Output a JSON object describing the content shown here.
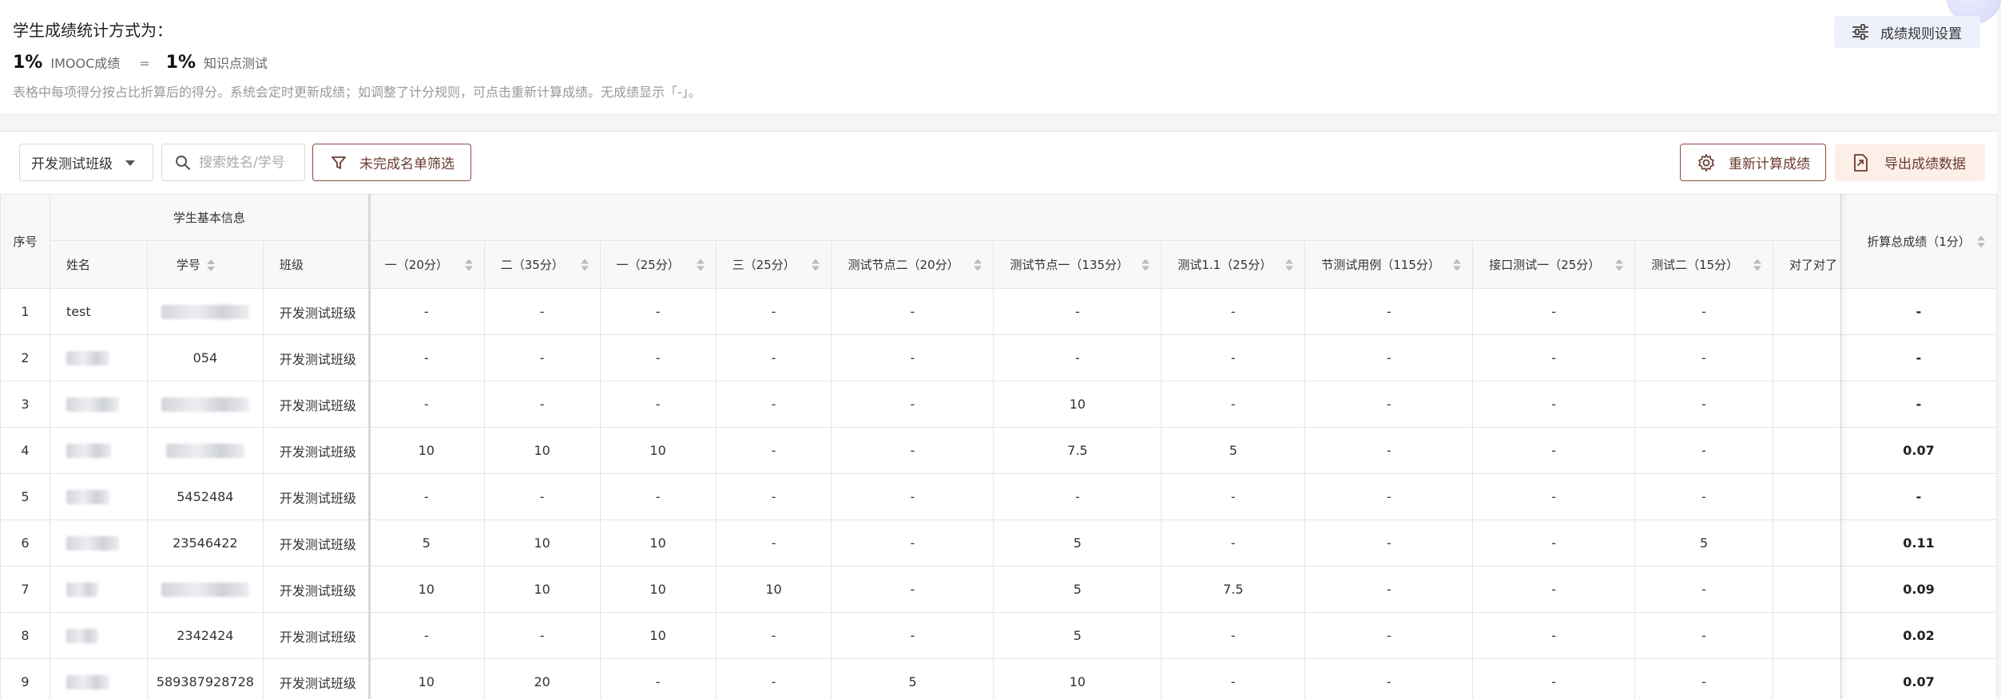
{
  "header": {
    "title": "学生成绩统计方式为：",
    "formula": {
      "part1_pct": "1%",
      "part1_label": "IMOOC成绩",
      "op": "=",
      "part2_pct": "1%",
      "part2_label": "知识点测试"
    },
    "hint": "表格中每项得分按占比折算后的得分。系统会定时更新成绩；如调整了计分规则，可点击重新计算成绩。无成绩显示「-」。",
    "rule_button": "成绩规则设置"
  },
  "toolbar": {
    "class_select": "开发测试班级",
    "search_placeholder": "搜索姓名/学号",
    "filter_button": "未完成名单筛选",
    "recalc_button": "重新计算成绩",
    "export_button": "导出成绩数据"
  },
  "table": {
    "index_header": "序号",
    "group_header": "学生基本信息",
    "info_columns": [
      "姓名",
      "学号",
      "班级"
    ],
    "score_columns": [
      "一（20分）",
      "二（35分）",
      "一（25分）",
      "三（25分）",
      "测试节点二（20分）",
      "测试节点一（135分）",
      "测试1.1（25分）",
      "节测试用例（115分）",
      "接口测试一（25分）",
      "测试二（15分）",
      "对了对了"
    ],
    "total_header": "折算总成绩（1分）",
    "rows": [
      {
        "idx": "1",
        "name": "test",
        "sid": "",
        "class": "开发测试班级",
        "scores": [
          "-",
          "-",
          "-",
          "-",
          "-",
          "-",
          "-",
          "-",
          "-",
          "-",
          ""
        ],
        "total": "-"
      },
      {
        "idx": "2",
        "name": "",
        "sid": "054",
        "class": "开发测试班级",
        "scores": [
          "-",
          "-",
          "-",
          "-",
          "-",
          "-",
          "-",
          "-",
          "-",
          "-",
          ""
        ],
        "total": "-"
      },
      {
        "idx": "3",
        "name": "",
        "sid": "",
        "class": "开发测试班级",
        "scores": [
          "-",
          "-",
          "-",
          "-",
          "-",
          "10",
          "-",
          "-",
          "-",
          "-",
          ""
        ],
        "total": "-"
      },
      {
        "idx": "4",
        "name": "",
        "sid": "",
        "class": "开发测试班级",
        "scores": [
          "10",
          "10",
          "10",
          "-",
          "-",
          "7.5",
          "5",
          "-",
          "-",
          "-",
          ""
        ],
        "total": "0.07"
      },
      {
        "idx": "5",
        "name": "",
        "sid": "5452484",
        "class": "开发测试班级",
        "scores": [
          "-",
          "-",
          "-",
          "-",
          "-",
          "-",
          "-",
          "-",
          "-",
          "-",
          ""
        ],
        "total": "-"
      },
      {
        "idx": "6",
        "name": "",
        "sid": "23546422",
        "class": "开发测试班级",
        "scores": [
          "5",
          "10",
          "10",
          "-",
          "-",
          "5",
          "-",
          "-",
          "-",
          "5",
          ""
        ],
        "total": "0.11"
      },
      {
        "idx": "7",
        "name": "",
        "sid": "",
        "class": "开发测试班级",
        "scores": [
          "10",
          "10",
          "10",
          "10",
          "-",
          "5",
          "7.5",
          "-",
          "-",
          "-",
          ""
        ],
        "total": "0.09"
      },
      {
        "idx": "8",
        "name": "",
        "sid": "2342424",
        "class": "开发测试班级",
        "scores": [
          "-",
          "-",
          "10",
          "-",
          "-",
          "5",
          "-",
          "-",
          "-",
          "-",
          ""
        ],
        "total": "0.02"
      },
      {
        "idx": "9",
        "name": "",
        "sid": "589387928728",
        "class": "开发测试班级",
        "scores": [
          "10",
          "20",
          "-",
          "-",
          "5",
          "10",
          "-",
          "-",
          "-",
          "-",
          ""
        ],
        "total": "0.07"
      }
    ]
  },
  "icons": {
    "rule": "sliders-icon",
    "search": "search-icon",
    "filter": "filter-icon",
    "recalc": "gear-refresh-icon",
    "export": "export-file-icon"
  }
}
